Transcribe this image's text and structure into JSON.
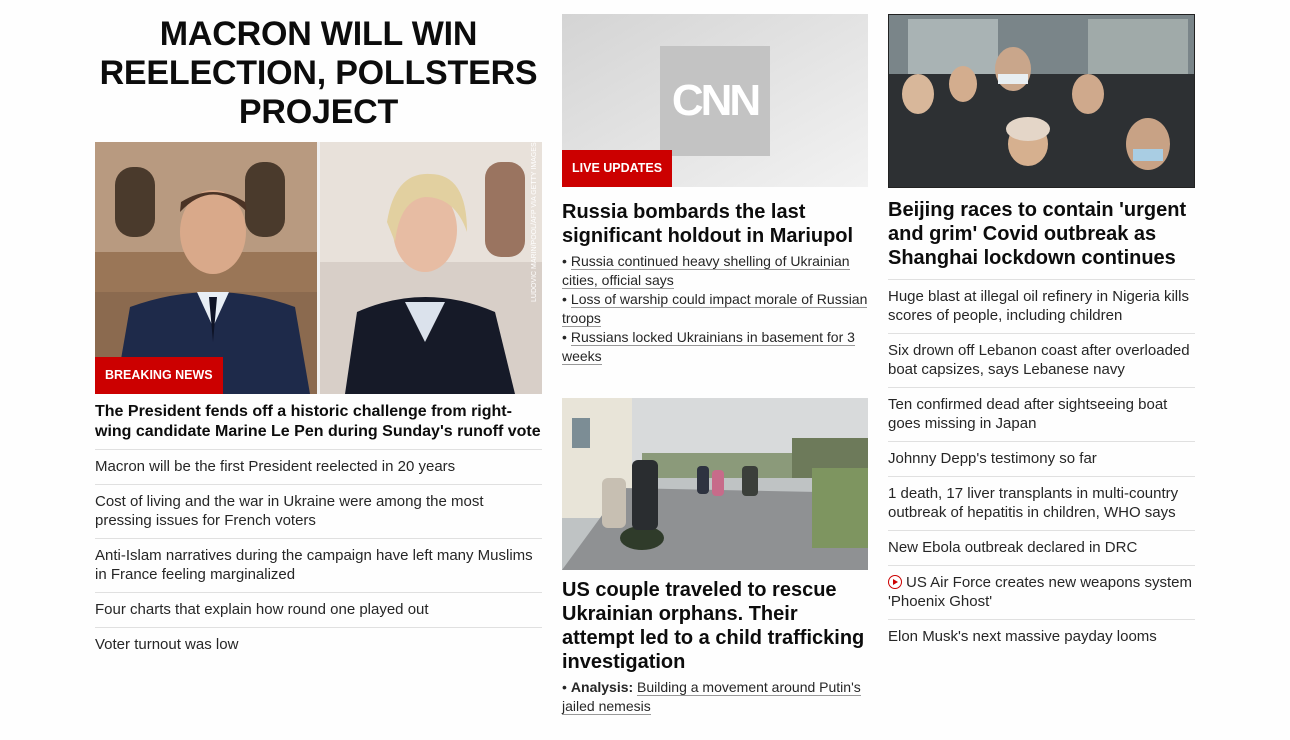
{
  "left": {
    "headline": "MACRON WILL WIN REELECTION, POLLSTERS PROJECT",
    "badge": "BREAKING NEWS",
    "photo_credit": "LUDOVIC MARIN/POOL/AFP VIA GETTY IMAGES",
    "lead": "The President fends off a historic challenge from right-wing candidate Marine Le Pen during Sunday's runoff vote",
    "stories": [
      "Macron will be the first President reelected in 20 years",
      "Cost of living and the war in Ukraine were among the most pressing issues for French voters",
      "Anti-Islam narratives during the campaign have left many Muslims in France feeling marginalized",
      "Four charts that explain how round one played out",
      "Voter turnout was low"
    ]
  },
  "middle": {
    "logo_text": "CNN",
    "badge": "LIVE UPDATES",
    "headline": "Russia bombards the last significant holdout in Mariupol",
    "bullets": [
      "Russia continued heavy shelling of Ukrainian cities, official says",
      "Loss of warship could impact morale of Russian troops",
      "Russians locked Ukrainians in basement for 3 weeks"
    ],
    "headline2": "US couple traveled to rescue Ukrainian orphans. Their attempt led to a child trafficking investigation",
    "analysis_label": "Analysis:",
    "analysis_text": "Building a movement around Putin's jailed nemesis"
  },
  "right": {
    "headline": "Beijing races to contain 'urgent and grim' Covid outbreak as Shanghai lockdown continues",
    "stories": [
      "Huge blast at illegal oil refinery in Nigeria kills scores of people, including children",
      "Six drown off Lebanon coast after overloaded boat capsizes, says Lebanese navy",
      "Ten confirmed dead after sightseeing boat goes missing in Japan",
      "Johnny Depp's testimony so far",
      "1 death, 17 liver transplants in multi-country outbreak of hepatitis in children, WHO says",
      "New Ebola outbreak declared in DRC",
      "US Air Force creates new weapons system 'Phoenix Ghost'",
      "Elon Musk's next massive payday looms"
    ],
    "video_story_index": 6
  },
  "colors": {
    "accent": "#cc0000",
    "text": "#0c0c0c",
    "divider": "#e0e0e0"
  }
}
